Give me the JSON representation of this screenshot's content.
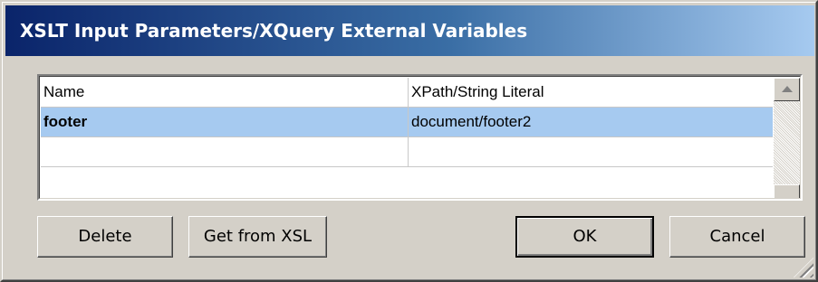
{
  "window": {
    "title": "XSLT Input Parameters/XQuery External Variables"
  },
  "table": {
    "columns": [
      "Name",
      "XPath/String Literal"
    ],
    "rows": [
      {
        "name": "footer",
        "value": "document/footer2",
        "selected": true
      },
      {
        "name": "",
        "value": "",
        "selected": false
      }
    ]
  },
  "buttons": {
    "delete": "Delete",
    "get_from_xsl": "Get from XSL",
    "ok": "OK",
    "cancel": "Cancel"
  },
  "colors": {
    "title_gradient_start": "#0a246a",
    "title_gradient_end": "#a6caf0",
    "selection": "#a6caf0",
    "face": "#d4d0c8"
  }
}
